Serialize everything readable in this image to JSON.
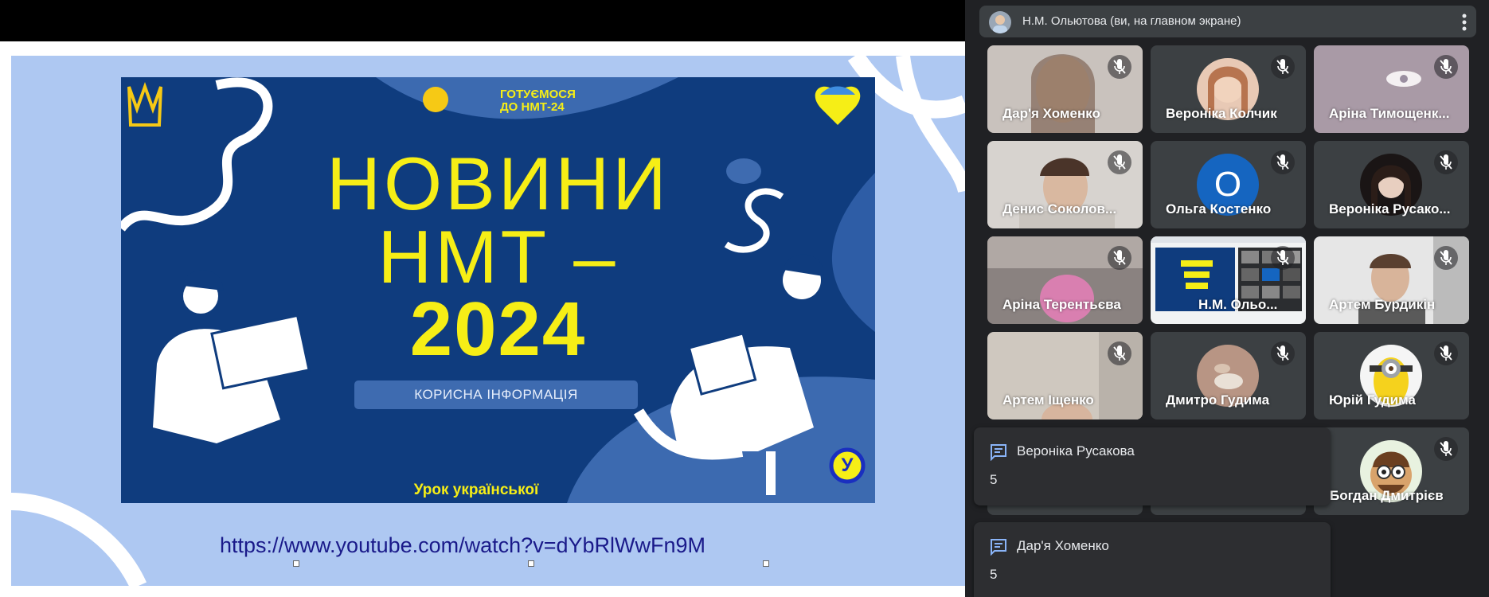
{
  "slide": {
    "poster": {
      "brand_line1": "ГОТУЄМОСЯ",
      "brand_line2": "ДО НМТ-24",
      "title_line1": "НОВИНИ",
      "title_line2": "НМТ –",
      "title_line3": "2024",
      "button_label": "КОРИСНА ІНФОРМАЦІЯ",
      "footer": "Урок української",
      "badge_letter": "У"
    },
    "link": "https://www.youtube.com/watch?v=dYbRlWwFn9M"
  },
  "presenter": {
    "label": "Н.М. Ольютова (ви, на главном экране)"
  },
  "participants": [
    {
      "name": "Дар'я Хоменко"
    },
    {
      "name": "Вероніка Колчик"
    },
    {
      "name": "Аріна Тимощенк..."
    },
    {
      "name": "Денис Соколов..."
    },
    {
      "name": "Ольга Костенко",
      "initial": "О"
    },
    {
      "name": "Вероніка Русако..."
    },
    {
      "name": "Аріна Терентьєва"
    },
    {
      "name": "Н.М. Ольо..."
    },
    {
      "name": "Артем Бурдикін"
    },
    {
      "name": "Артем Іщенко"
    },
    {
      "name": "Дмитро Гудима"
    },
    {
      "name": "Юрій Гудима"
    },
    {
      "name": "Богдан Дмитрієв"
    }
  ],
  "notifications": [
    {
      "sender": "Вероніка Русакова",
      "message": "5"
    },
    {
      "sender": "Дар'я Хоменко",
      "message": "5"
    }
  ],
  "colors": {
    "poster_bg": "#0f3c7e",
    "poster_yellow": "#f6ee16",
    "slide_bg": "#aec8f2",
    "panel_bg": "#202124",
    "tile_bg": "#3c4043",
    "chat_icon": "#8ab4f8"
  }
}
